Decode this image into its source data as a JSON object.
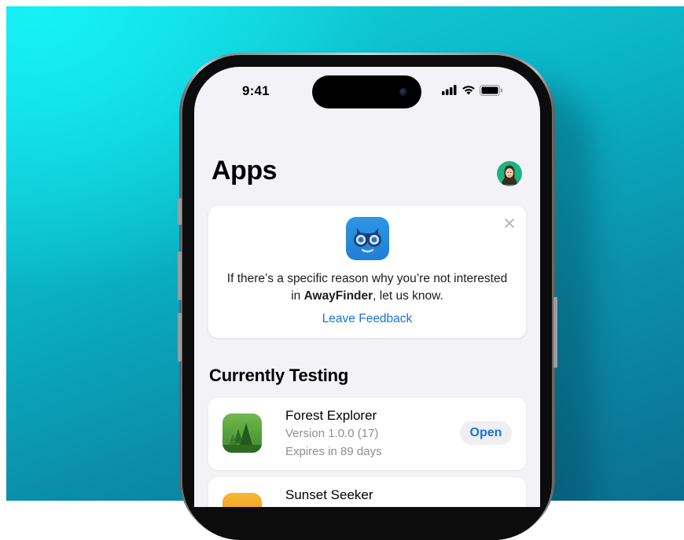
{
  "status_bar": {
    "time": "9:41"
  },
  "page": {
    "title": "Apps"
  },
  "feedback_card": {
    "text_before": "If there’s a specific reason why you’re not interested in ",
    "app_name": "AwayFinder",
    "text_after": ", let us know.",
    "link_label": "Leave Feedback"
  },
  "section": {
    "title": "Currently Testing"
  },
  "apps": [
    {
      "name": "Forest Explorer",
      "version": "Version 1.0.0 (17)",
      "expiry": "Expires in 89 days",
      "action": "Open"
    },
    {
      "name": "Sunset Seeker"
    }
  ],
  "colors": {
    "accent": "#1a73d9",
    "background": "#f2f2f7"
  }
}
